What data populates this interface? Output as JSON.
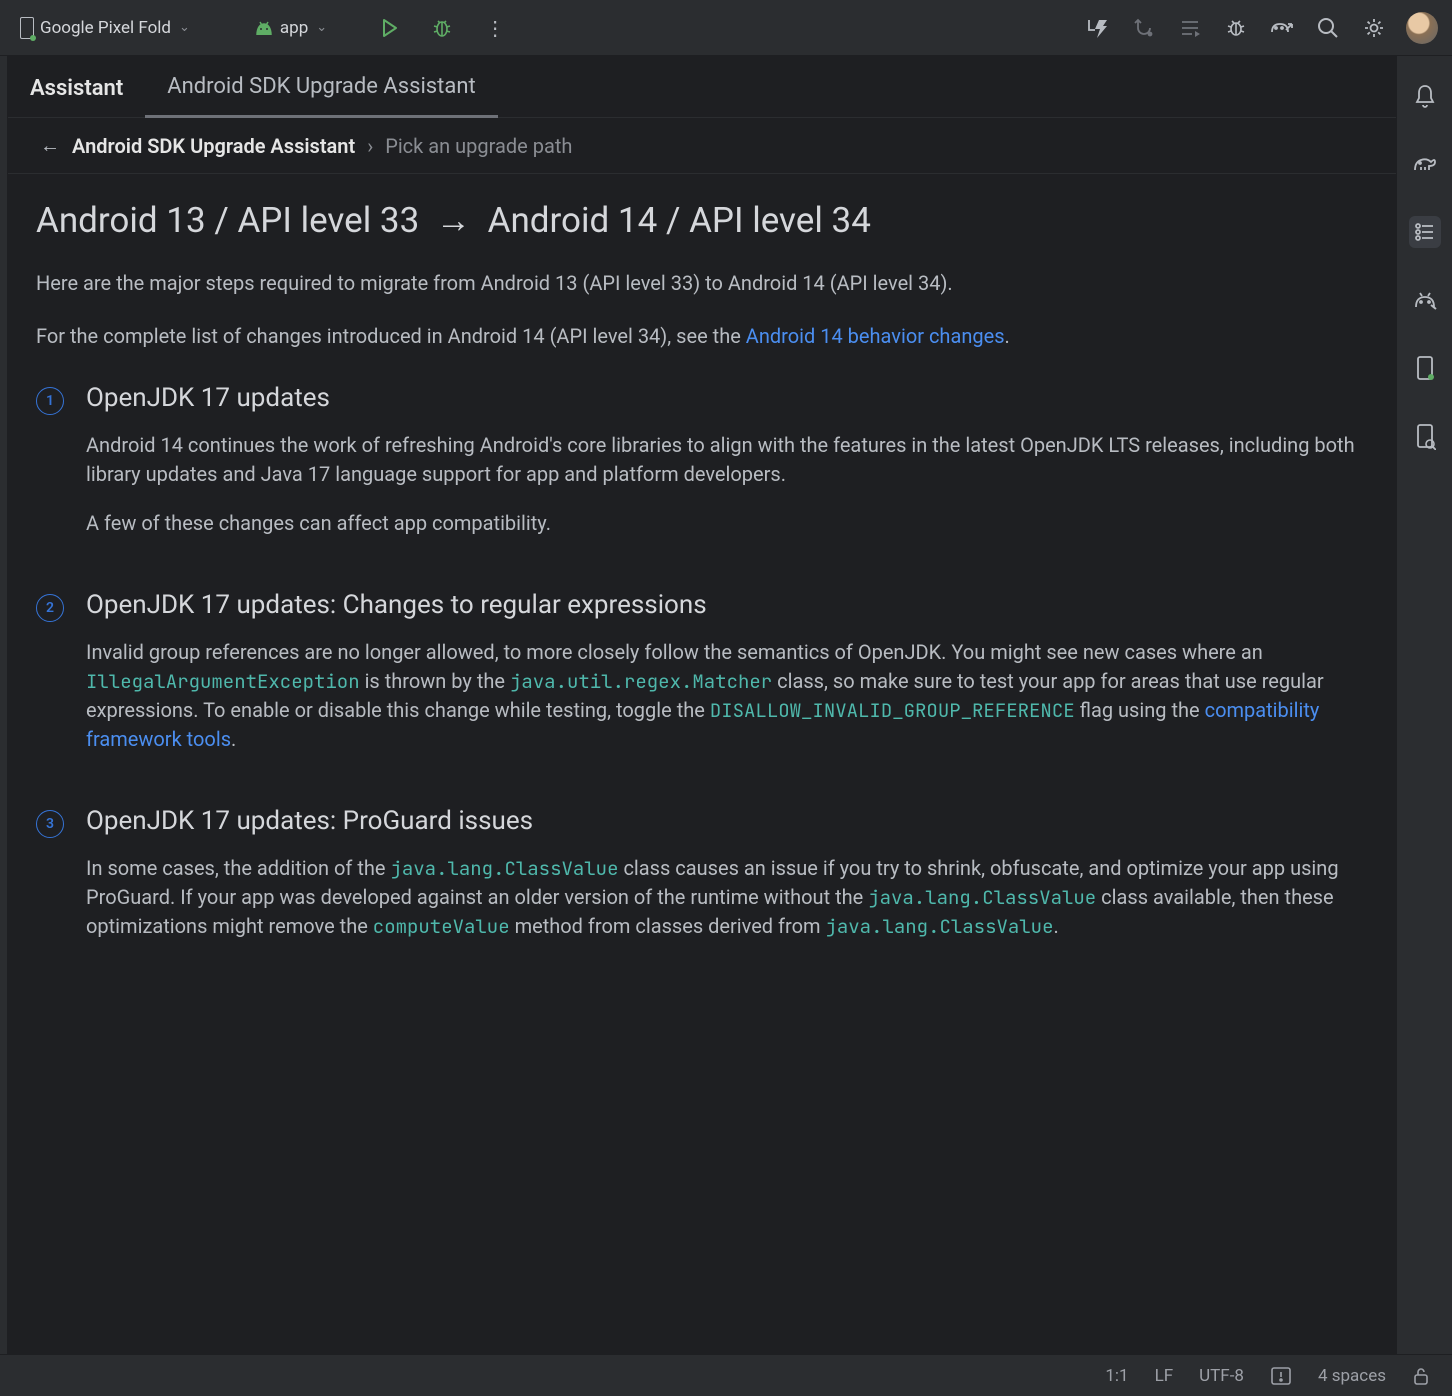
{
  "toolbar": {
    "device": "Google Pixel Fold",
    "module": "app"
  },
  "tabs": {
    "assistant": "Assistant",
    "sdk_upgrade": "Android SDK Upgrade Assistant"
  },
  "breadcrumb": {
    "root": "Android SDK Upgrade Assistant",
    "current": "Pick an upgrade path"
  },
  "page": {
    "title_from": "Android 13 / API level 33",
    "title_to": "Android 14 / API level 34",
    "intro1": "Here are the major steps required to migrate from Android 13 (API level 33) to Android 14 (API level 34).",
    "intro2_pre": "For the complete list of changes introduced in Android 14 (API level 34), see the ",
    "intro2_link": "Android 14 behavior changes",
    "intro2_post": "."
  },
  "steps": [
    {
      "num": "1",
      "title": "OpenJDK 17 updates",
      "p1": "Android 14 continues the work of refreshing Android's core libraries to align with the features in the latest OpenJDK LTS releases, including both library updates and Java 17 language support for app and platform developers.",
      "p2": "A few of these changes can affect app compatibility."
    },
    {
      "num": "2",
      "title": "OpenJDK 17 updates: Changes to regular expressions",
      "body": {
        "a": "Invalid group references are no longer allowed, to more closely follow the semantics of OpenJDK. You might see new cases where an ",
        "code1": "IllegalArgumentException",
        "b": " is thrown by the ",
        "code2": "java.util.regex.Matcher",
        "c": " class, so make sure to test your app for areas that use regular expressions. To enable or disable this change while testing, toggle the ",
        "code3": "DISALLOW_INVALID_GROUP_REFERENCE",
        "d": " flag using the ",
        "link": "compatibility framework tools",
        "e": "."
      }
    },
    {
      "num": "3",
      "title": "OpenJDK 17 updates: ProGuard issues",
      "body": {
        "a": "In some cases, the addition of the ",
        "code1": "java.lang.ClassValue",
        "b": " class causes an issue if you try to shrink, obfuscate, and optimize your app using ProGuard. If your app was developed against an older version of the runtime without the ",
        "code2": "java.lang.ClassValue",
        "c": " class available, then these optimizations might remove the ",
        "code3": "computeValue",
        "d": " method from classes derived from ",
        "code4": "java.lang.ClassValue",
        "e": "."
      }
    }
  ],
  "status": {
    "pos": "1:1",
    "eol": "LF",
    "enc": "UTF-8",
    "indent": "4 spaces"
  }
}
